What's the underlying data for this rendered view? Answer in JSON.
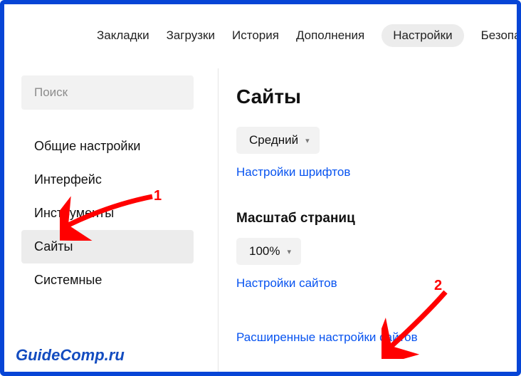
{
  "topnav": {
    "items": [
      {
        "label": "Закладки"
      },
      {
        "label": "Загрузки"
      },
      {
        "label": "История"
      },
      {
        "label": "Дополнения"
      },
      {
        "label": "Настройки",
        "active": true
      },
      {
        "label": "Безопа"
      }
    ]
  },
  "sidebar": {
    "search_placeholder": "Поиск",
    "items": [
      {
        "label": "Общие настройки"
      },
      {
        "label": "Интерфейс"
      },
      {
        "label": "Инструменты"
      },
      {
        "label": "Сайты",
        "selected": true
      },
      {
        "label": "Системные"
      }
    ]
  },
  "main": {
    "title": "Сайты",
    "font_size_select": "Средний",
    "font_settings_link": "Настройки шрифтов",
    "zoom_heading": "Масштаб страниц",
    "zoom_select": "100%",
    "site_settings_link": "Настройки сайтов",
    "advanced_link": "Расширенные настройки сайтов"
  },
  "annotations": {
    "marker1": "1",
    "marker2": "2"
  },
  "watermark": "GuideComp.ru"
}
